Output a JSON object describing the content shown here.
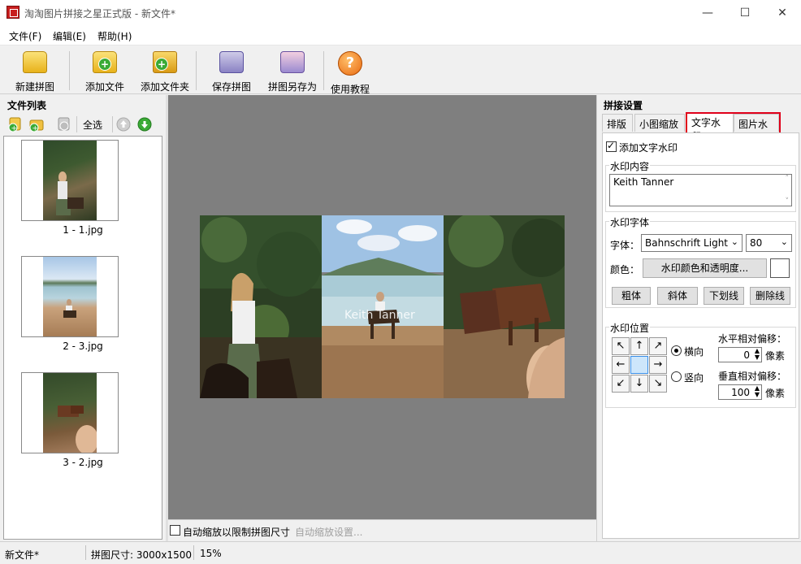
{
  "window": {
    "title": "淘淘图片拼接之星正式版 - 新文件*",
    "minimize": "—",
    "maximize": "☐",
    "close": "✕"
  },
  "menu": {
    "file": "文件(F)",
    "edit": "编辑(E)",
    "help": "帮助(H)"
  },
  "toolbar": {
    "new_collage": "新建拼图",
    "add_files": "添加文件",
    "add_folder": "添加文件夹",
    "save_collage": "保存拼图",
    "save_as": "拼图另存为",
    "tutorial": "使用教程",
    "help_glyph": "?"
  },
  "left_panel": {
    "title": "文件列表",
    "select_all": "全选",
    "files": [
      {
        "label": "1 - 1.jpg"
      },
      {
        "label": "2 - 3.jpg"
      },
      {
        "label": "3 - 2.jpg"
      }
    ]
  },
  "canvas": {
    "watermark_text": "Keith Tanner",
    "auto_scale_label": "自动缩放以限制拼图尺寸",
    "auto_scale_settings": "自动缩放设置..."
  },
  "right_panel": {
    "title": "拼接设置",
    "tabs": [
      "排版",
      "小图缩放",
      "文字水印",
      "图片水印"
    ],
    "active_tab": "文字水印",
    "add_watermark_label": "添加文字水印",
    "add_watermark_checked": true,
    "content_group": "水印内容",
    "content_value": "Keith Tanner",
    "font_group": "水印字体",
    "font_label": "字体：",
    "font_name": "Bahnschrift Light",
    "font_size": "80",
    "color_label": "颜色：",
    "color_button": "水印颜色和透明度...",
    "color_value": "#ffffff",
    "bold": "粗体",
    "italic": "斜体",
    "underline": "下划线",
    "strikethrough": "删除线",
    "position_group": "水印位置",
    "horizontal": "横向",
    "vertical": "竖向",
    "horizontal_checked": true,
    "h_offset_label": "水平相对偏移：",
    "h_offset_value": "0",
    "v_offset_label": "垂直相对偏移：",
    "v_offset_value": "100",
    "pixel_unit": "像素",
    "arrows": {
      "nw": "↖",
      "n": "↑",
      "ne": "↗",
      "w": "←",
      "center": "",
      "e": "→",
      "sw": "↙",
      "s": "↓",
      "se": "↘"
    }
  },
  "status": {
    "filename": "新文件*",
    "size": "拼图尺寸: 3000x1500",
    "zoom": "15%"
  }
}
